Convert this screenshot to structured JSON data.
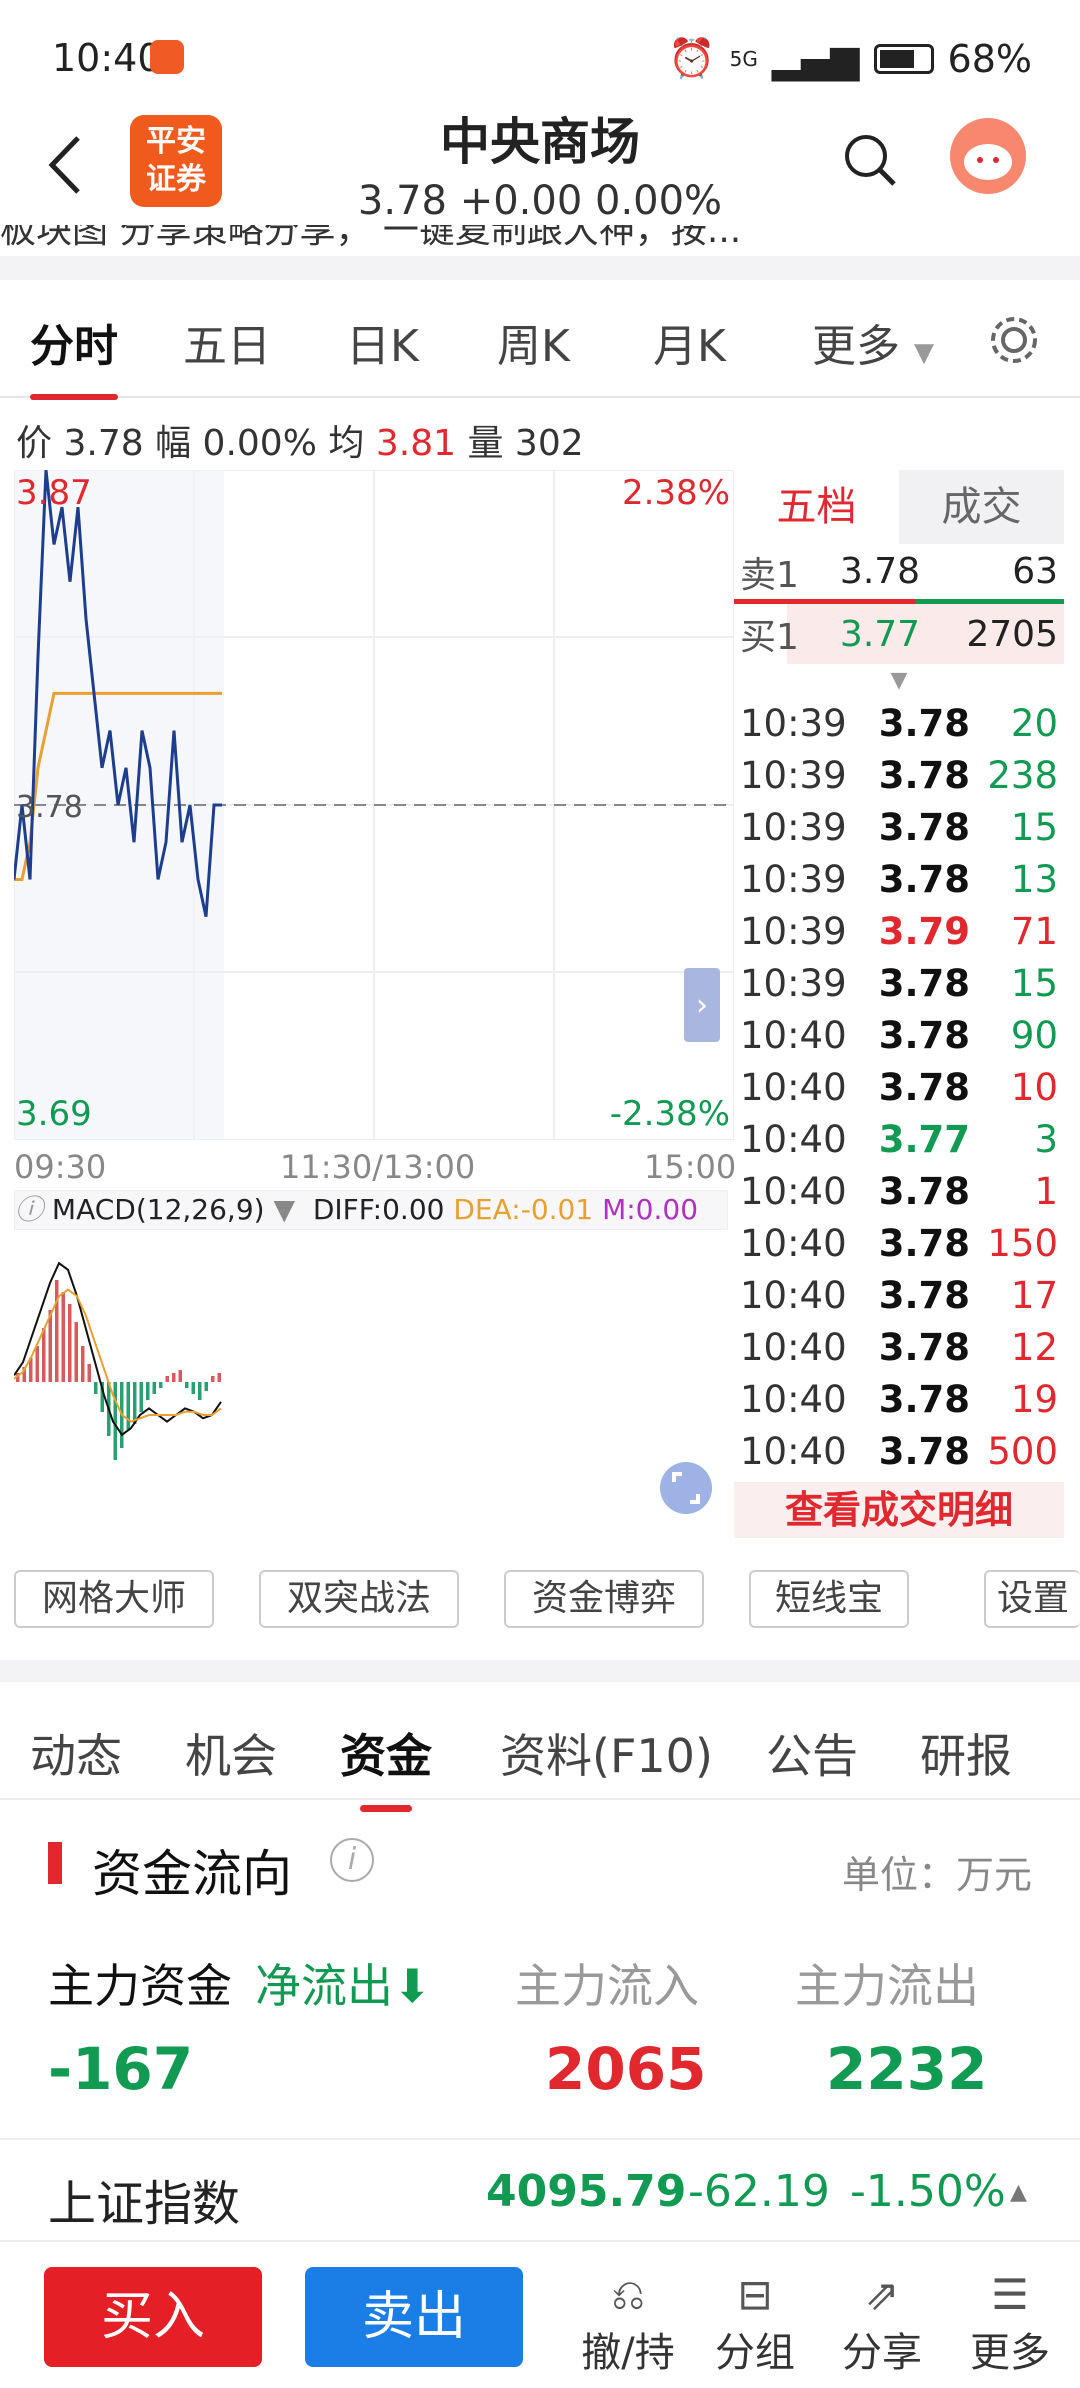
{
  "status": {
    "time": "10:40",
    "network": "5G",
    "battery": "68%"
  },
  "header": {
    "logo_line1": "平安",
    "logo_line2": "证券",
    "title": "中央商场",
    "subtitle": "3.78 +0.00 0.00%"
  },
  "ticker": "板块图  分享策略分享，  一键复制跟大神，按...",
  "kline_tabs": [
    "分时",
    "五日",
    "日K",
    "周K",
    "月K",
    "更多"
  ],
  "quote": {
    "price_label": "价",
    "price": "3.78",
    "range_label": "幅",
    "range": "0.00%",
    "avg_label": "均",
    "avg": "3.81",
    "vol_label": "量",
    "vol": "302"
  },
  "chart": {
    "ymax": "3.87",
    "ymid": "3.78",
    "ymin": "3.69",
    "pct_max": "2.38%",
    "pct_min": "-2.38%",
    "t_start": "09:30",
    "t_mid": "11:30/13:00",
    "t_end": "15:00",
    "price_line": [
      3.76,
      3.78,
      3.76,
      3.82,
      3.87,
      3.85,
      3.86,
      3.84,
      3.86,
      3.83,
      3.81,
      3.79,
      3.8,
      3.78,
      3.79,
      3.77,
      3.8,
      3.79,
      3.76,
      3.77,
      3.8,
      3.77,
      3.78,
      3.76,
      3.75,
      3.78,
      3.78
    ],
    "avg_line": [
      3.76,
      3.76,
      3.77,
      3.79,
      3.8,
      3.81,
      3.81,
      3.81,
      3.81,
      3.81,
      3.81,
      3.81,
      3.81,
      3.81,
      3.81,
      3.81,
      3.81,
      3.81,
      3.81,
      3.81,
      3.81,
      3.81,
      3.81,
      3.81,
      3.81,
      3.81,
      3.81
    ]
  },
  "macd": {
    "label": "MACD(12,26,9)",
    "diff": "DIFF:0.00",
    "dea": "DEA:-0.01",
    "m": "M:0.00",
    "bars": [
      3,
      5,
      8,
      12,
      18,
      24,
      34,
      30,
      26,
      20,
      12,
      6,
      -4,
      -10,
      -18,
      -26,
      -22,
      -16,
      -14,
      -10,
      -6,
      -4,
      -2,
      2,
      3,
      4,
      -2,
      -4,
      -6,
      -3,
      2,
      3
    ],
    "diff_line": [
      2,
      6,
      14,
      22,
      30,
      36,
      34,
      26,
      16,
      6,
      -4,
      -12,
      -16,
      -14,
      -10,
      -8,
      -10,
      -12,
      -10,
      -8,
      -9,
      -11,
      -10,
      -6
    ],
    "dea_line": [
      1,
      3,
      8,
      14,
      20,
      26,
      28,
      26,
      20,
      12,
      4,
      -4,
      -10,
      -12,
      -11,
      -10,
      -10,
      -10,
      -10,
      -9,
      -9,
      -10,
      -10,
      -8
    ]
  },
  "depth": {
    "tab_five": "五档",
    "tab_trade": "成交",
    "sell": {
      "label": "卖1",
      "price": "3.78",
      "vol": "63"
    },
    "buy": {
      "label": "买1",
      "price": "3.77",
      "vol": "2705"
    },
    "trades": [
      {
        "t": "10:39",
        "p": "3.78",
        "v": "20",
        "pc": "n",
        "vc": "g"
      },
      {
        "t": "10:39",
        "p": "3.78",
        "v": "238",
        "pc": "n",
        "vc": "g"
      },
      {
        "t": "10:39",
        "p": "3.78",
        "v": "15",
        "pc": "n",
        "vc": "g"
      },
      {
        "t": "10:39",
        "p": "3.78",
        "v": "13",
        "pc": "n",
        "vc": "g"
      },
      {
        "t": "10:39",
        "p": "3.79",
        "v": "71",
        "pc": "r",
        "vc": "r"
      },
      {
        "t": "10:39",
        "p": "3.78",
        "v": "15",
        "pc": "n",
        "vc": "g"
      },
      {
        "t": "10:40",
        "p": "3.78",
        "v": "90",
        "pc": "n",
        "vc": "g"
      },
      {
        "t": "10:40",
        "p": "3.78",
        "v": "10",
        "pc": "n",
        "vc": "r"
      },
      {
        "t": "10:40",
        "p": "3.77",
        "v": "3",
        "pc": "g",
        "vc": "g"
      },
      {
        "t": "10:40",
        "p": "3.78",
        "v": "1",
        "pc": "n",
        "vc": "r"
      },
      {
        "t": "10:40",
        "p": "3.78",
        "v": "150",
        "pc": "n",
        "vc": "r"
      },
      {
        "t": "10:40",
        "p": "3.78",
        "v": "17",
        "pc": "n",
        "vc": "r"
      },
      {
        "t": "10:40",
        "p": "3.78",
        "v": "12",
        "pc": "n",
        "vc": "r"
      },
      {
        "t": "10:40",
        "p": "3.78",
        "v": "19",
        "pc": "n",
        "vc": "r"
      },
      {
        "t": "10:40",
        "p": "3.78",
        "v": "500",
        "pc": "n",
        "vc": "r"
      }
    ],
    "detail_btn": "查看成交明细"
  },
  "tools": [
    "网格大师",
    "双突战法",
    "资金博弈",
    "短线宝",
    "设置"
  ],
  "info_tabs": [
    "动态",
    "机会",
    "资金",
    "资料(F10)",
    "公告",
    "研报"
  ],
  "fund": {
    "title": "资金流向",
    "info": "i",
    "unit": "单位：万元",
    "main_label": "主力资金",
    "net_label": "净流出",
    "in_label": "主力流入",
    "out_label": "主力流出",
    "net_val": "-167",
    "in_val": "2065",
    "out_val": "2232"
  },
  "index": {
    "name": "上证指数",
    "value": "4095.79",
    "change": "-62.19",
    "pct": "-1.50%"
  },
  "bottom": {
    "buy": "买入",
    "sell": "卖出",
    "cancel": "撤/持",
    "group": "分组",
    "share": "分享",
    "more": "更多"
  },
  "colors": {
    "red": "#e0282e",
    "green": "#119a52",
    "blue_line": "#1d3d8f",
    "avg_line": "#e8a030",
    "sell_btn": "#1a7ee6"
  }
}
